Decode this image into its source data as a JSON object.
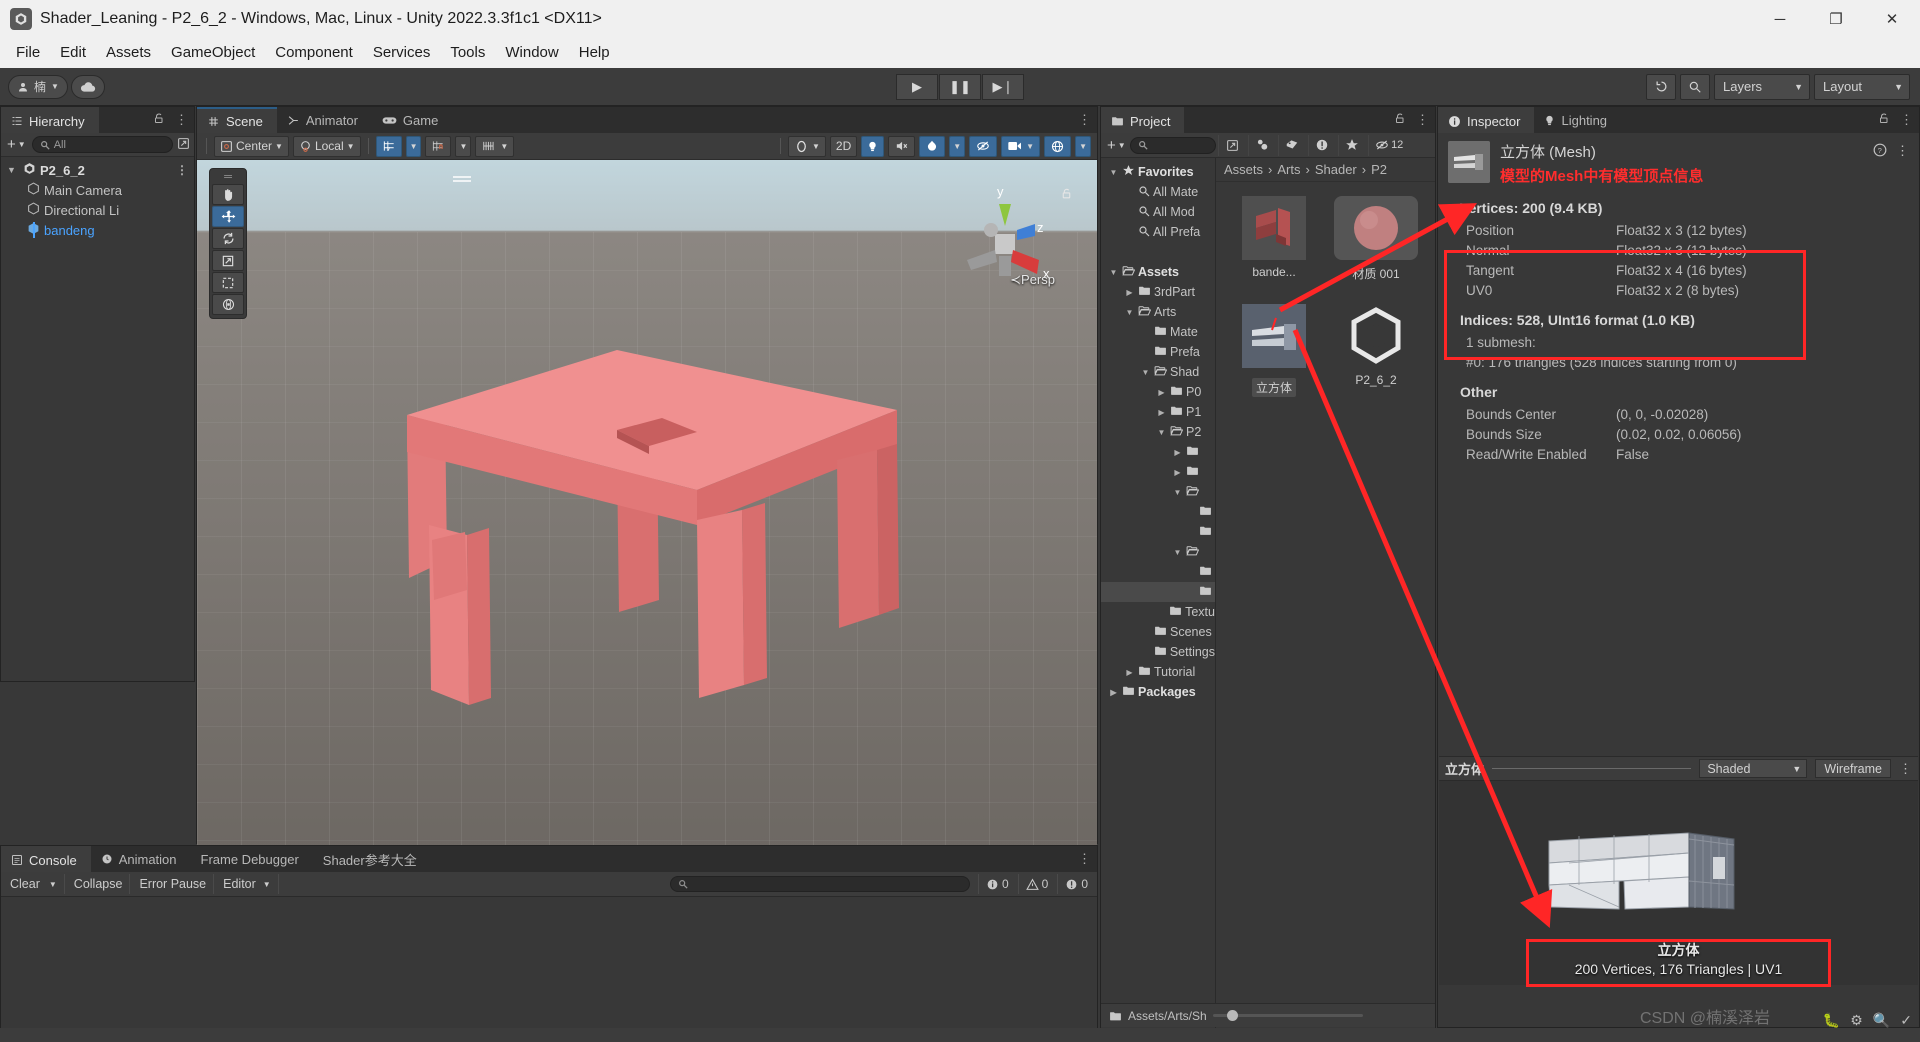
{
  "window": {
    "title": "Shader_Leaning - P2_6_2 - Windows, Mac, Linux - Unity 2022.3.3f1c1 <DX11>",
    "minimize": "─",
    "maximize": "❐",
    "close": "✕"
  },
  "menu": [
    "File",
    "Edit",
    "Assets",
    "GameObject",
    "Component",
    "Services",
    "Tools",
    "Window",
    "Help"
  ],
  "toolbar": {
    "account_label": "楠",
    "cloud_icon": "cloud-icon",
    "play": "▶",
    "pause": "❚❚",
    "step": "▶❘",
    "undo_history_icon": "history-icon",
    "search_icon": "search-icon",
    "layers": "Layers",
    "layout": "Layout"
  },
  "hierarchy": {
    "tab": "Hierarchy",
    "search_placeholder": "All",
    "add_label": "+",
    "items": [
      {
        "label": "P2_6_2",
        "type": "scene",
        "selected": false
      },
      {
        "label": "Main Camera",
        "type": "object",
        "selected": false
      },
      {
        "label": "Directional Li",
        "type": "object",
        "selected": false
      },
      {
        "label": "bandeng",
        "type": "prefab",
        "selected": true
      }
    ]
  },
  "scene": {
    "tabs": [
      "Scene",
      "Animator",
      "Game"
    ],
    "active_tab": "Scene",
    "pivot": "Center",
    "space": "Local",
    "toggle_2d": "2D",
    "gizmo_axes": {
      "x": "x",
      "y": "y",
      "z": "z"
    },
    "projection": "≺Persp",
    "tools": [
      "hand-tool",
      "move-tool",
      "rotate-tool",
      "scale-tool",
      "rect-tool",
      "transform-tool"
    ],
    "active_tool": "move-tool"
  },
  "project": {
    "tab": "Project",
    "search_placeholder": "",
    "hidden_count": "12",
    "breadcrumb": [
      "Assets",
      "Arts",
      "Shader",
      "P2"
    ],
    "tree": [
      {
        "label": "Favorites",
        "depth": 0,
        "caret": "▼",
        "bold": true,
        "icon": "star"
      },
      {
        "label": "All Mate",
        "depth": 1,
        "caret": "",
        "icon": "search"
      },
      {
        "label": "All Mod",
        "depth": 1,
        "caret": "",
        "icon": "search"
      },
      {
        "label": "All Prefa",
        "depth": 1,
        "caret": "",
        "icon": "search"
      },
      {
        "label": "",
        "depth": 0,
        "caret": "",
        "icon": ""
      },
      {
        "label": "Assets",
        "depth": 0,
        "caret": "▼",
        "bold": true,
        "icon": "folder-open"
      },
      {
        "label": "3rdPart",
        "depth": 1,
        "caret": "▶",
        "icon": "folder"
      },
      {
        "label": "Arts",
        "depth": 1,
        "caret": "▼",
        "icon": "folder-open"
      },
      {
        "label": "Mate",
        "depth": 2,
        "caret": "",
        "icon": "folder"
      },
      {
        "label": "Prefa",
        "depth": 2,
        "caret": "",
        "icon": "folder"
      },
      {
        "label": "Shad",
        "depth": 2,
        "caret": "▼",
        "icon": "folder-open"
      },
      {
        "label": "P0",
        "depth": 3,
        "caret": "▶",
        "icon": "folder"
      },
      {
        "label": "P1",
        "depth": 3,
        "caret": "▶",
        "icon": "folder"
      },
      {
        "label": "P2",
        "depth": 3,
        "caret": "▼",
        "icon": "folder-open"
      },
      {
        "label": "",
        "depth": 4,
        "caret": "▶",
        "icon": "folder"
      },
      {
        "label": "",
        "depth": 4,
        "caret": "▶",
        "icon": "folder"
      },
      {
        "label": "",
        "depth": 4,
        "caret": "▼",
        "icon": "folder-open"
      },
      {
        "label": "",
        "depth": 5,
        "caret": "",
        "icon": "folder"
      },
      {
        "label": "",
        "depth": 5,
        "caret": "",
        "icon": "folder"
      },
      {
        "label": "",
        "depth": 4,
        "caret": "▼",
        "icon": "folder-open"
      },
      {
        "label": "",
        "depth": 5,
        "caret": "",
        "icon": "folder"
      },
      {
        "label": "",
        "depth": 5,
        "caret": "",
        "icon": "folder",
        "selected": true
      },
      {
        "label": "Textu",
        "depth": 3,
        "caret": "",
        "icon": "folder"
      },
      {
        "label": "Scenes",
        "depth": 2,
        "caret": "",
        "icon": "folder"
      },
      {
        "label": "Settings",
        "depth": 2,
        "caret": "",
        "icon": "folder"
      },
      {
        "label": "Tutorial",
        "depth": 1,
        "caret": "▶",
        "icon": "folder"
      },
      {
        "label": "Packages",
        "depth": 0,
        "caret": "▶",
        "bold": true,
        "icon": "folder"
      }
    ],
    "assets": [
      {
        "label": "bande...",
        "kind": "model",
        "selected": false
      },
      {
        "label": "材质 001",
        "kind": "material",
        "selected": false
      },
      {
        "label": "立方体",
        "kind": "mesh",
        "selected": true
      },
      {
        "label": "P2_6_2",
        "kind": "scene",
        "selected": false
      }
    ],
    "status_path": "Assets/Arts/Sh"
  },
  "inspector": {
    "tabs": [
      "Inspector",
      "Lighting"
    ],
    "active_tab": "Inspector",
    "asset_title": "立方体 (Mesh)",
    "annotation": "模型的Mesh中有模型顶点信息",
    "help_icon": "help-icon",
    "kebab_icon": "kebab-icon",
    "vertices_header": "Vertices: 200 (9.4 KB)",
    "vertex_attributes": [
      {
        "name": "Position",
        "format": "Float32 x 3 (12 bytes)"
      },
      {
        "name": "Normal",
        "format": "Float32 x 3 (12 bytes)"
      },
      {
        "name": "Tangent",
        "format": "Float32 x 4 (16 bytes)"
      },
      {
        "name": "UV0",
        "format": "Float32 x 2 (8 bytes)"
      }
    ],
    "indices_header": "Indices: 528, UInt16 format (1.0 KB)",
    "submesh_label": "1 submesh:",
    "submesh_detail": "#0: 176 triangles (528 indices starting from 0)",
    "other_header": "Other",
    "other_rows": [
      {
        "key": "Bounds Center",
        "value": "(0, 0, -0.02028)"
      },
      {
        "key": "Bounds Size",
        "value": "(0.02, 0.02, 0.06056)"
      },
      {
        "key": "Read/Write Enabled",
        "value": "False"
      }
    ],
    "preview": {
      "title": "立方体",
      "shading_mode": "Shaded",
      "wireframe_button": "Wireframe",
      "caption_title": "立方体",
      "caption_stats": "200 Vertices, 176 Triangles | UV1"
    },
    "accent_red": "#ff2626"
  },
  "console": {
    "tabs": [
      "Console",
      "Animation",
      "Frame Debugger",
      "Shader参考大全"
    ],
    "active_tab": "Console",
    "clear": "Clear",
    "collapse": "Collapse",
    "error_pause": "Error Pause",
    "editor": "Editor",
    "search_placeholder": "",
    "counts": {
      "log": "0",
      "warning": "0",
      "error": "0"
    }
  },
  "statusbar": {
    "watermark": "CSDN @楠溪泽岩"
  }
}
